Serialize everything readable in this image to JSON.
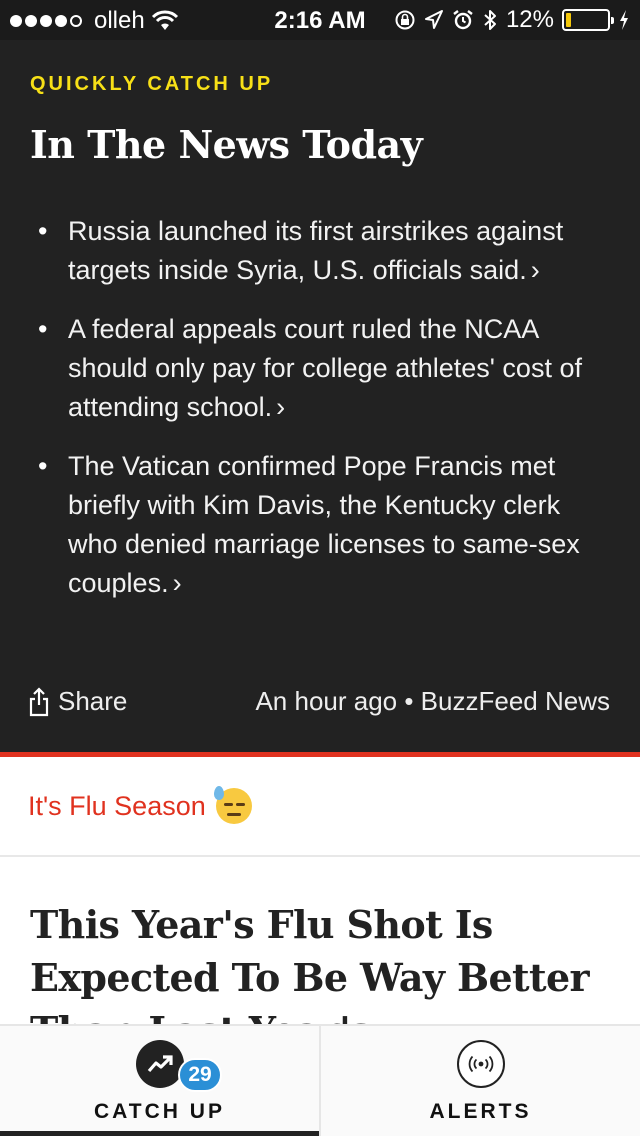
{
  "status_bar": {
    "carrier": "olleh",
    "time": "2:16 AM",
    "battery": "12%",
    "battery_level": 0.12,
    "battery_color": "#f4c80c",
    "signal_bars_filled": 4,
    "signal_bars_total": 5,
    "icons": [
      "signal-dots-icon",
      "wifi-icon",
      "orientation-lock-icon",
      "location-arrow-icon",
      "alarm-icon",
      "bluetooth-icon",
      "battery-icon",
      "charging-bolt-icon"
    ]
  },
  "news_card": {
    "eyebrow": "QUICKLY CATCH UP",
    "headline": "In The News Today",
    "bullets": [
      "Russia launched its first airstrikes against targets inside Syria, U.S. officials said.",
      "A federal appeals court ruled the NCAA should only pay for college athletes' cost of attending school.",
      "The Vatican confirmed Pope Francis met briefly with Kim Davis, the Kentucky clerk who denied marriage licenses to same-sex couples."
    ],
    "chevron": "›",
    "share_label": "Share",
    "meta": "An hour ago • BuzzFeed News",
    "accent_color": "#f7e017",
    "background": "#222222"
  },
  "section": {
    "label": "It's Flu Season",
    "emoji": "downcast-face-sweat-emoji",
    "color": "#e0321f"
  },
  "article": {
    "title": "This Year's Flu Shot Is Expected To Be Way Better Than Last Year's"
  },
  "tab_bar": {
    "tabs": [
      {
        "label": "CATCH UP",
        "badge": "29",
        "icon": "trending-arrow-icon",
        "active": true
      },
      {
        "label": "ALERTS",
        "icon": "broadcast-icon",
        "active": false
      }
    ],
    "badge_color": "#2b8fd6"
  }
}
